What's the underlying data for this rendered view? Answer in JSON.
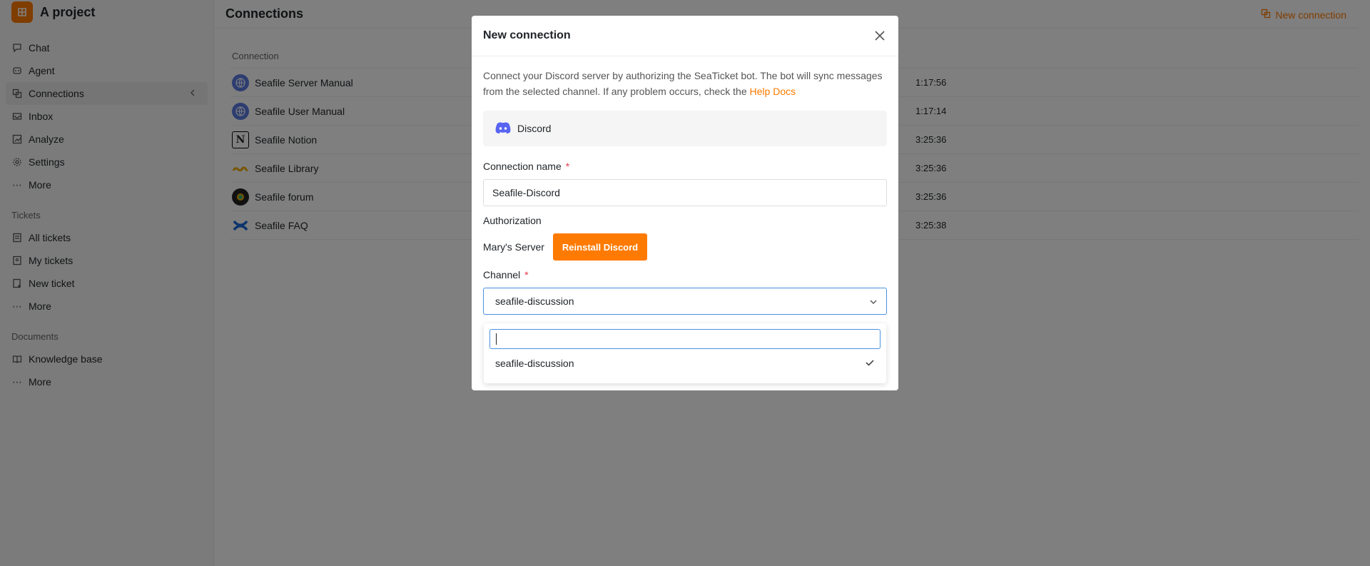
{
  "app": {
    "project_name": "A project"
  },
  "sidebar": {
    "main_items": [
      {
        "label": "Chat",
        "icon": "chat-icon"
      },
      {
        "label": "Agent",
        "icon": "agent-icon"
      },
      {
        "label": "Connections",
        "icon": "connections-icon",
        "active": true
      },
      {
        "label": "Inbox",
        "icon": "inbox-icon"
      },
      {
        "label": "Analyze",
        "icon": "analyze-icon"
      },
      {
        "label": "Settings",
        "icon": "gear-icon"
      },
      {
        "label": "More",
        "icon": "more-icon"
      }
    ],
    "tickets_title": "Tickets",
    "tickets_items": [
      {
        "label": "All tickets",
        "icon": "list-icon"
      },
      {
        "label": "My tickets",
        "icon": "user-list-icon"
      },
      {
        "label": "New ticket",
        "icon": "new-ticket-icon"
      },
      {
        "label": "More",
        "icon": "more-icon"
      }
    ],
    "documents_title": "Documents",
    "documents_items": [
      {
        "label": "Knowledge base",
        "icon": "book-icon"
      },
      {
        "label": "More",
        "icon": "more-icon"
      }
    ]
  },
  "main": {
    "title": "Connections",
    "new_connection_label": "New connection",
    "column_header": "Connection",
    "rows": [
      {
        "name": "Seafile Server Manual",
        "time": "1:17:56",
        "icon": "globe-icon"
      },
      {
        "name": "Seafile User Manual",
        "time": "1:17:14",
        "icon": "globe-icon"
      },
      {
        "name": "Seafile Notion",
        "time": "3:25:36",
        "icon": "notion-icon"
      },
      {
        "name": "Seafile Library",
        "time": "3:25:36",
        "icon": "library-icon"
      },
      {
        "name": "Seafile forum",
        "time": "3:25:36",
        "icon": "forum-icon"
      },
      {
        "name": "Seafile FAQ",
        "time": "3:25:38",
        "icon": "confluence-icon"
      }
    ]
  },
  "modal": {
    "title": "New connection",
    "description": "Connect your Discord server by authorizing the SeaTicket bot. The bot will sync messages from the selected channel. If any problem occurs, check the",
    "help_link": "Help Docs",
    "platform_label": "Discord",
    "connection_name_label": "Connection name",
    "connection_name_value": "Seafile-Discord",
    "authorization_label": "Authorization",
    "server_name": "Mary's Server",
    "reinstall_button": "Reinstall Discord",
    "channel_label": "Channel",
    "channel_value": "seafile-discussion",
    "dropdown_search_value": "",
    "dropdown_options": [
      "seafile-discussion"
    ]
  },
  "colors": {
    "accent": "#ff7a00",
    "discord": "#5865f2",
    "focus": "#4a90e2",
    "required": "#e63946"
  }
}
